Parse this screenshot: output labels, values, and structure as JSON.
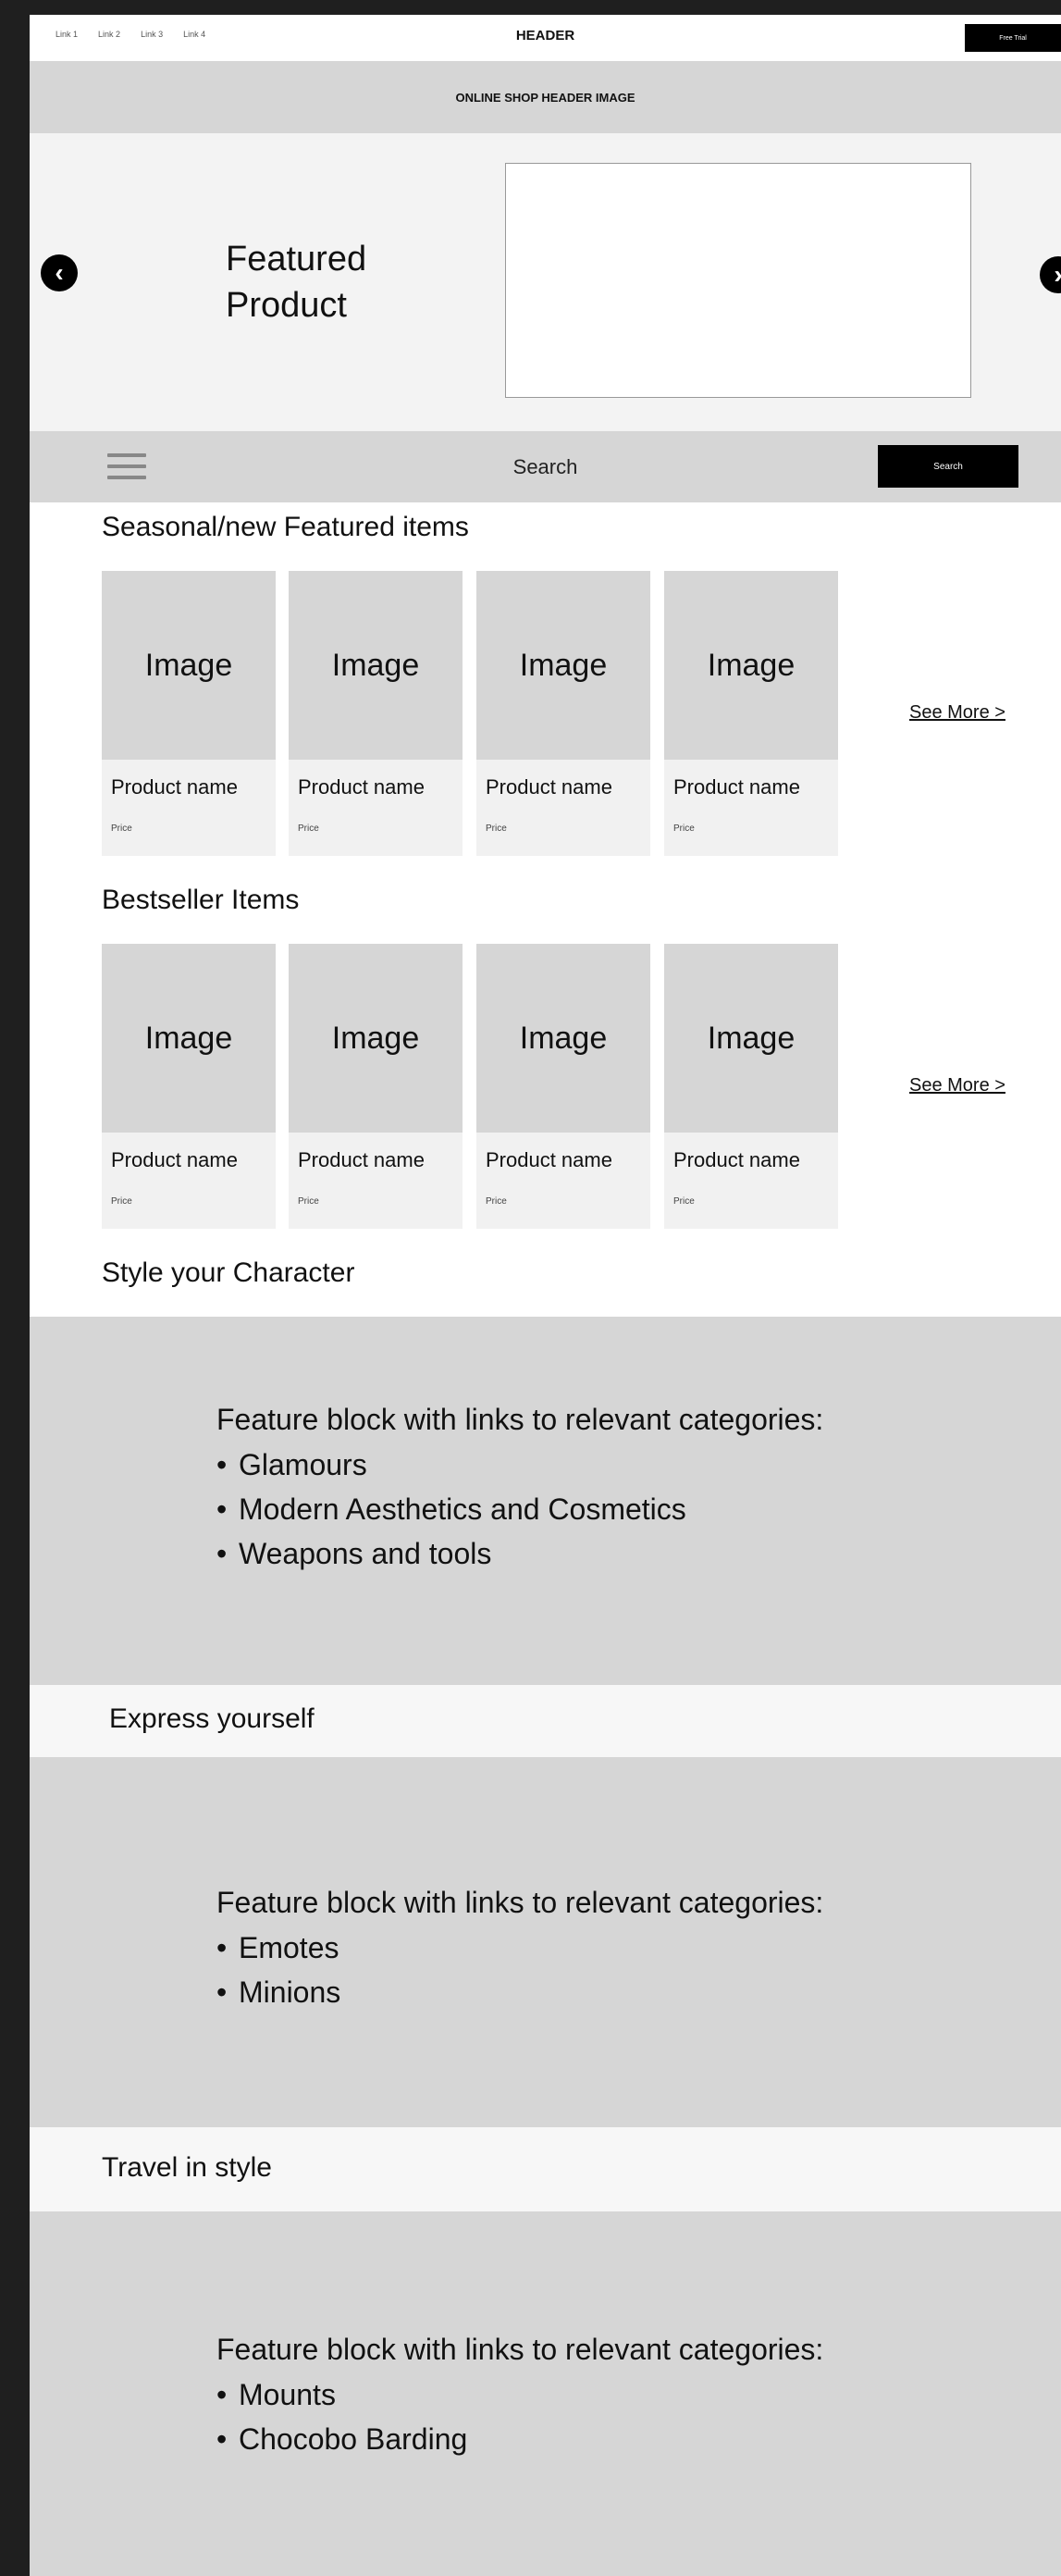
{
  "topbar": {
    "links": [
      "Link 1",
      "Link 2",
      "Link 3",
      "Link 4"
    ],
    "title": "HEADER",
    "button_label": "Free Trial"
  },
  "header_image": {
    "label": "ONLINE SHOP HEADER IMAGE"
  },
  "hero": {
    "title": "Featured Product",
    "prev_icon": "chevron-left-icon",
    "next_icon": "chevron-right-icon"
  },
  "searchbar": {
    "menu_icon": "hamburger-menu-icon",
    "label": "Search",
    "button_label": "Search"
  },
  "seasonal": {
    "title": "Seasonal/new Featured items",
    "see_more": "See More >",
    "cards": [
      {
        "image": "Image",
        "name": "Product name",
        "price": "Price"
      },
      {
        "image": "Image",
        "name": "Product name",
        "price": "Price"
      },
      {
        "image": "Image",
        "name": "Product name",
        "price": "Price"
      },
      {
        "image": "Image",
        "name": "Product name",
        "price": "Price"
      }
    ]
  },
  "bestseller": {
    "title": "Bestseller Items",
    "see_more": "See More >",
    "cards": [
      {
        "image": "Image",
        "name": "Product name",
        "price": "Price"
      },
      {
        "image": "Image",
        "name": "Product name",
        "price": "Price"
      },
      {
        "image": "Image",
        "name": "Product name",
        "price": "Price"
      },
      {
        "image": "Image",
        "name": "Product name",
        "price": "Price"
      }
    ]
  },
  "style_character": {
    "title": "Style your Character",
    "intro": "Feature block with links to relevant categories:",
    "items": [
      "Glamours",
      "Modern Aesthetics and Cosmetics",
      "Weapons and tools"
    ]
  },
  "express_yourself": {
    "title": "Express yourself",
    "intro": "Feature block with links to relevant categories:",
    "items": [
      "Emotes",
      "Minions"
    ]
  },
  "travel_style": {
    "title": "Travel in style",
    "intro": "Feature block with links to relevant categories:",
    "items": [
      "Mounts",
      "Chocobo Barding"
    ]
  }
}
